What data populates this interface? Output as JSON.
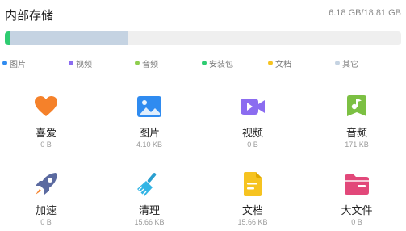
{
  "header": {
    "title": "内部存储",
    "usage": "6.18 GB/18.81 GB"
  },
  "storage_bar": {
    "segments": [
      {
        "name": "安装包",
        "fraction": 0.012,
        "color": "#2ecc71"
      },
      {
        "name": "其它",
        "fraction": 0.3,
        "color": "#c5d3e2"
      }
    ],
    "track_color": "#efefef"
  },
  "legend": [
    {
      "label": "图片",
      "color": "#2f8bf0"
    },
    {
      "label": "视频",
      "color": "#8b6cf0"
    },
    {
      "label": "音频",
      "color": "#8fce4e"
    },
    {
      "label": "安装包",
      "color": "#2ecc71"
    },
    {
      "label": "文档",
      "color": "#f6c320"
    },
    {
      "label": "其它",
      "color": "#c5d3e2"
    }
  ],
  "categories": [
    {
      "label": "喜爱",
      "size": "0 B",
      "icon": "heart-icon",
      "color": "#f5812a"
    },
    {
      "label": "图片",
      "size": "4.10 KB",
      "icon": "image-icon",
      "color": "#2f8bf0"
    },
    {
      "label": "视频",
      "size": "0 B",
      "icon": "video-icon",
      "color": "#8b6cf0"
    },
    {
      "label": "音频",
      "size": "171 KB",
      "icon": "music-icon",
      "color": "#7cc043"
    },
    {
      "label": "加速",
      "size": "0 B",
      "icon": "rocket-icon",
      "color": "#5b6aa0"
    },
    {
      "label": "清理",
      "size": "15.66 KB",
      "icon": "broom-icon",
      "color": "#33b5e5"
    },
    {
      "label": "文档",
      "size": "15.66 KB",
      "icon": "document-icon",
      "color": "#f6c320"
    },
    {
      "label": "大文件",
      "size": "0 B",
      "icon": "folder-icon",
      "color": "#e2487a"
    }
  ]
}
